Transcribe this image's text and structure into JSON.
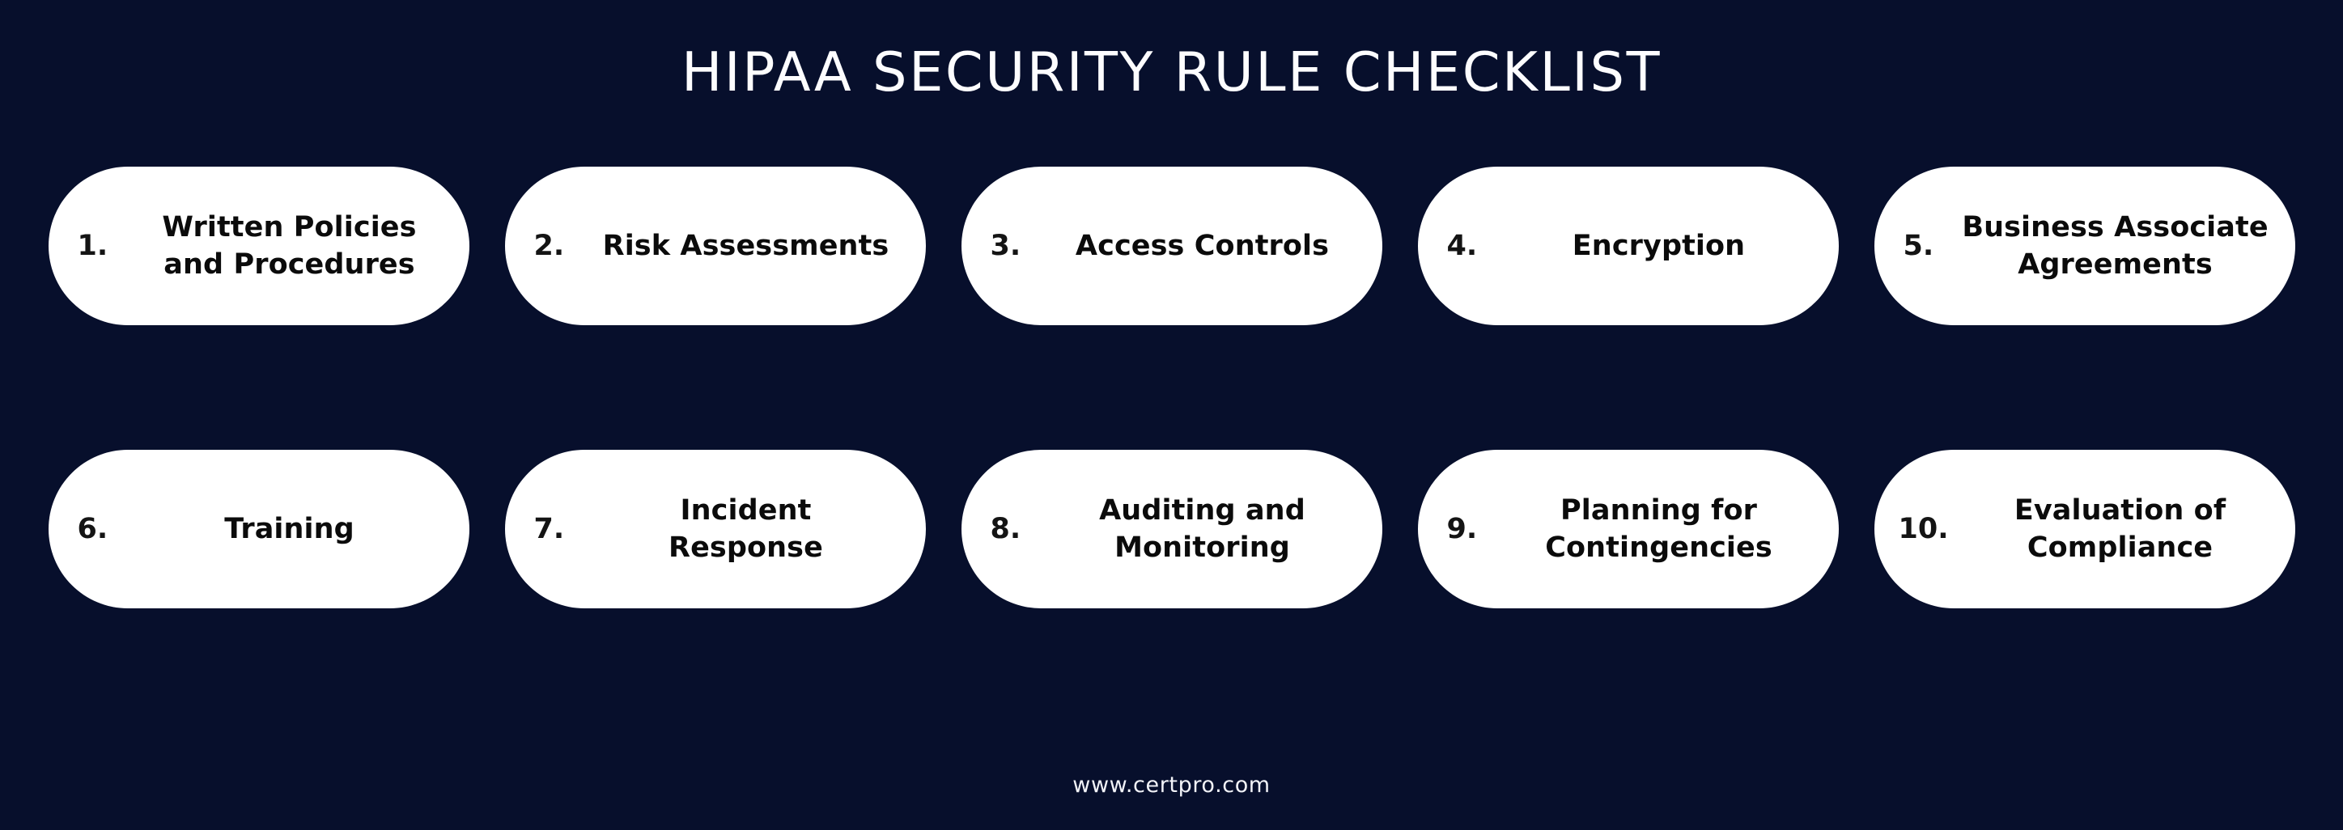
{
  "theme": {
    "background_color": "#070F2C",
    "pill_color": "#FFFFFF",
    "title_color": "#FDFDFF",
    "pill_text_color": "#0B0B0B",
    "footer_color": "#F2F3F8"
  },
  "header": {
    "title": "HIPAA SECURITY RULE CHECKLIST"
  },
  "checklist": {
    "rows": [
      {
        "items": [
          {
            "number": "1.",
            "label": "Written Policies and Procedures",
            "lines": [
              "Written Policies",
              "and Procedures"
            ]
          },
          {
            "number": "2.",
            "label": "Risk Assessments",
            "lines": [
              "Risk Assessments"
            ]
          },
          {
            "number": "3.",
            "label": "Access Controls",
            "lines": [
              "Access Controls"
            ]
          },
          {
            "number": "4.",
            "label": "Encryption",
            "lines": [
              "Encryption"
            ]
          },
          {
            "number": "5.",
            "label": "Business Associate Agreements",
            "lines": [
              "Business Associate",
              "Agreements"
            ]
          }
        ]
      },
      {
        "items": [
          {
            "number": "6.",
            "label": "Training",
            "lines": [
              "Training"
            ]
          },
          {
            "number": "7.",
            "label": "Incident Response",
            "lines": [
              "Incident",
              "Response"
            ]
          },
          {
            "number": "8.",
            "label": "Auditing and Monitoring",
            "lines": [
              "Auditing and",
              "Monitoring"
            ]
          },
          {
            "number": "9.",
            "label": "Planning for Contingencies",
            "lines": [
              "Planning for",
              "Contingencies"
            ]
          },
          {
            "number": "10.",
            "label": "Evaluation of Compliance",
            "lines": [
              "Evaluation of",
              "Compliance"
            ]
          }
        ]
      }
    ]
  },
  "footer": {
    "url": "www.certpro.com"
  }
}
